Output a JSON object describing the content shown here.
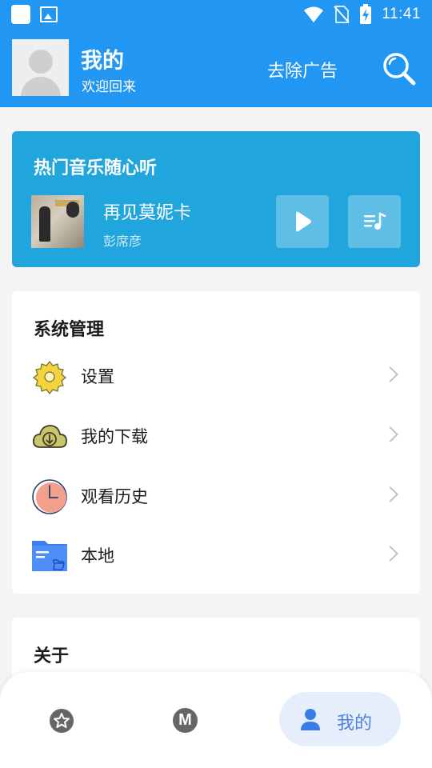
{
  "status_bar": {
    "time": "11:41"
  },
  "header": {
    "title": "我的",
    "subtitle": "欢迎回来",
    "remove_ads": "去除广告"
  },
  "music_card": {
    "title": "热门音乐随心听",
    "song": "再见莫妮卡",
    "artist": "彭席彦"
  },
  "system": {
    "title": "系统管理",
    "items": [
      {
        "label": "设置",
        "icon": "gear-icon"
      },
      {
        "label": "我的下载",
        "icon": "cloud-download-icon"
      },
      {
        "label": "观看历史",
        "icon": "clock-icon"
      },
      {
        "label": "本地",
        "icon": "folder-icon"
      }
    ]
  },
  "about": {
    "title": "关于"
  },
  "bottom_nav": {
    "items": [
      {
        "icon": "star-icon"
      },
      {
        "icon": "m-icon",
        "glyph": "M"
      },
      {
        "icon": "person-icon",
        "label": "我的"
      }
    ],
    "active_color": "#4e82e0"
  },
  "colors": {
    "primary": "#2196f3",
    "music_card": "#21a5dd"
  }
}
